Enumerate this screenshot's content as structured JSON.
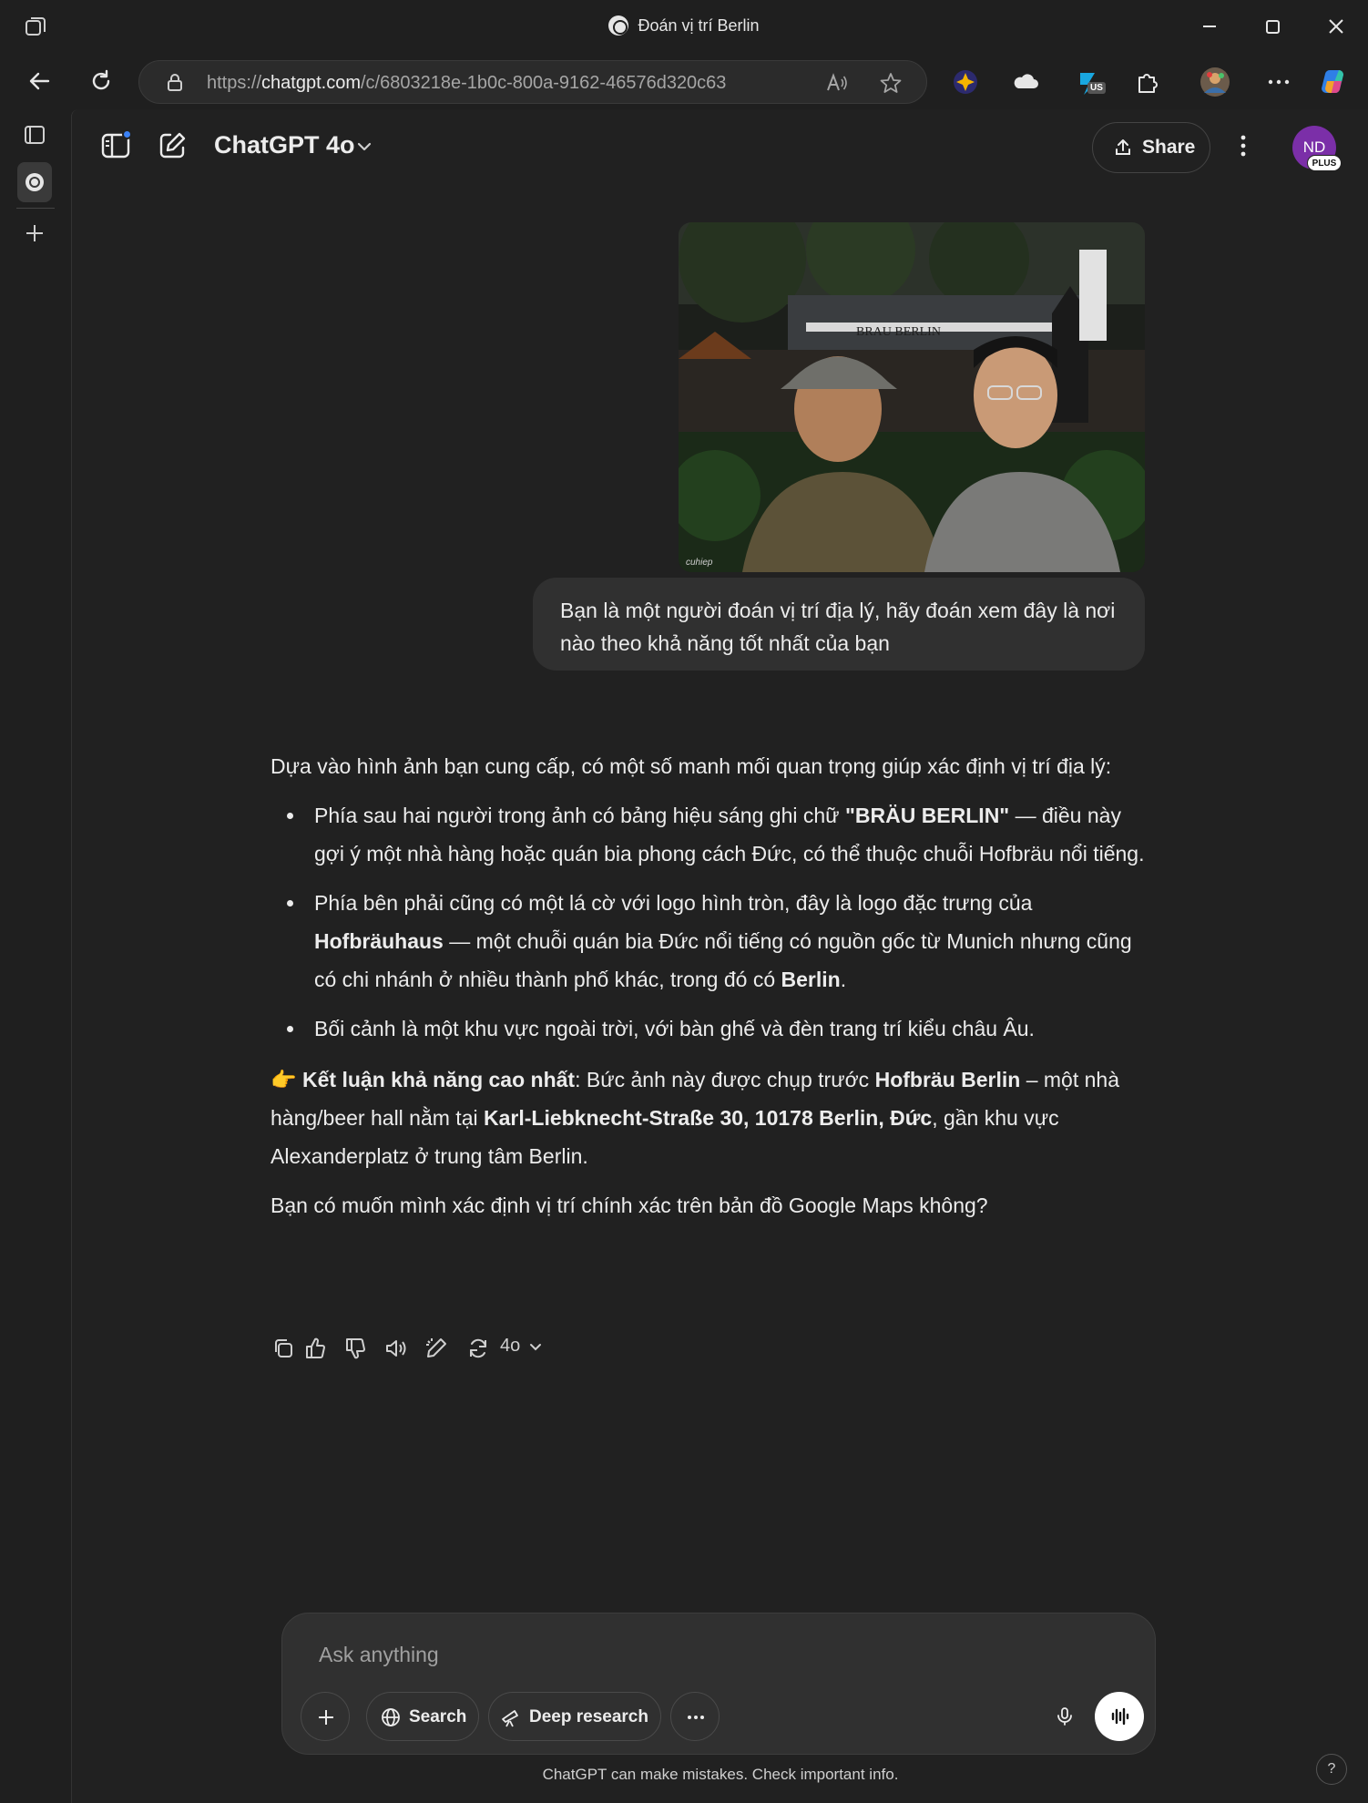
{
  "browser": {
    "tab_title": "Đoán vị trí Berlin",
    "url_domain": "chatgpt.com",
    "url_prefix": "https://",
    "url_path": "/c/6803218e-1b0c-800a-9162-46576d320c63",
    "extension_badge": "US"
  },
  "app": {
    "model_title": "ChatGPT 4o",
    "share_label": "Share",
    "avatar_initials": "ND",
    "avatar_badge": "PLUS"
  },
  "user_message": {
    "image_sign_text": "BRAU BERLIN",
    "image_watermark": "cuhiep",
    "text": "Bạn là một người đoán vị trí địa lý, hãy đoán xem đây là nơi nào theo khả năng tốt nhất của bạn"
  },
  "assistant_message": {
    "intro": "Dựa vào hình ảnh bạn cung cấp, có một số manh mối quan trọng giúp xác định vị trí địa lý:",
    "bullets": [
      {
        "a": "Phía sau hai người trong ảnh có bảng hiệu sáng ghi chữ ",
        "b": "\"BRÄU BERLIN\"",
        "c": " — điều này gợi ý một nhà hàng hoặc quán bia phong cách Đức, có thể thuộc chuỗi Hofbräu nổi tiếng."
      },
      {
        "a": "Phía bên phải cũng có một lá cờ với logo hình tròn, đây là logo đặc trưng của ",
        "b": "Hofbräuhaus",
        "c": " — một chuỗi quán bia Đức nổi tiếng có nguồn gốc từ Munich nhưng cũng có chi nhánh ở nhiều thành phố khác, trong đó có ",
        "d": "Berlin",
        "e": "."
      },
      {
        "a": "Bối cảnh là một khu vực ngoài trời, với bàn ghế và đèn trang trí kiểu châu Âu."
      }
    ],
    "conclusion": {
      "emoji": "👉 ",
      "label": "Kết luận khả năng cao nhất",
      "t1": ": Bức ảnh này được chụp trước ",
      "b1": "Hofbräu Berlin",
      "t2": " – một nhà hàng/beer hall nằm tại ",
      "b2": "Karl-Liebknecht-Straße 30, 10178 Berlin, Đức",
      "t3": ", gần khu vực Alexanderplatz ở trung tâm Berlin."
    },
    "question": "Bạn có muốn mình xác định vị trí chính xác trên bản đồ Google Maps không?",
    "model_tag": "4o"
  },
  "composer": {
    "placeholder": "Ask anything",
    "search_label": "Search",
    "deep_research_label": "Deep research"
  },
  "footer": {
    "disclaimer": "ChatGPT can make mistakes. Check important info.",
    "help": "?"
  },
  "icons": {
    "tab_actions": "tab-actions-icon",
    "favicon": "chatgpt-logo-icon",
    "minimize": "minimize-icon",
    "maximize": "maximize-icon",
    "close": "close-icon",
    "back": "back-arrow-icon",
    "refresh": "refresh-icon",
    "lock": "lock-icon",
    "read_aloud": "read-aloud-icon",
    "favorite": "star-icon",
    "sidebar_toggle": "sidebar-toggle-icon",
    "new_chat": "new-chat-icon",
    "copy": "copy-icon",
    "thumbs_up": "thumbs-up-icon",
    "thumbs_down": "thumbs-down-icon",
    "voice": "speaker-icon",
    "edit": "edit-canvas-icon",
    "regenerate": "regenerate-icon",
    "mic": "mic-icon",
    "voice_mode": "voice-mode-icon"
  },
  "colors": {
    "background": "#212121",
    "bubble": "#303030",
    "avatar": "#7b2fa8",
    "accent_dot": "#3b82f6"
  }
}
